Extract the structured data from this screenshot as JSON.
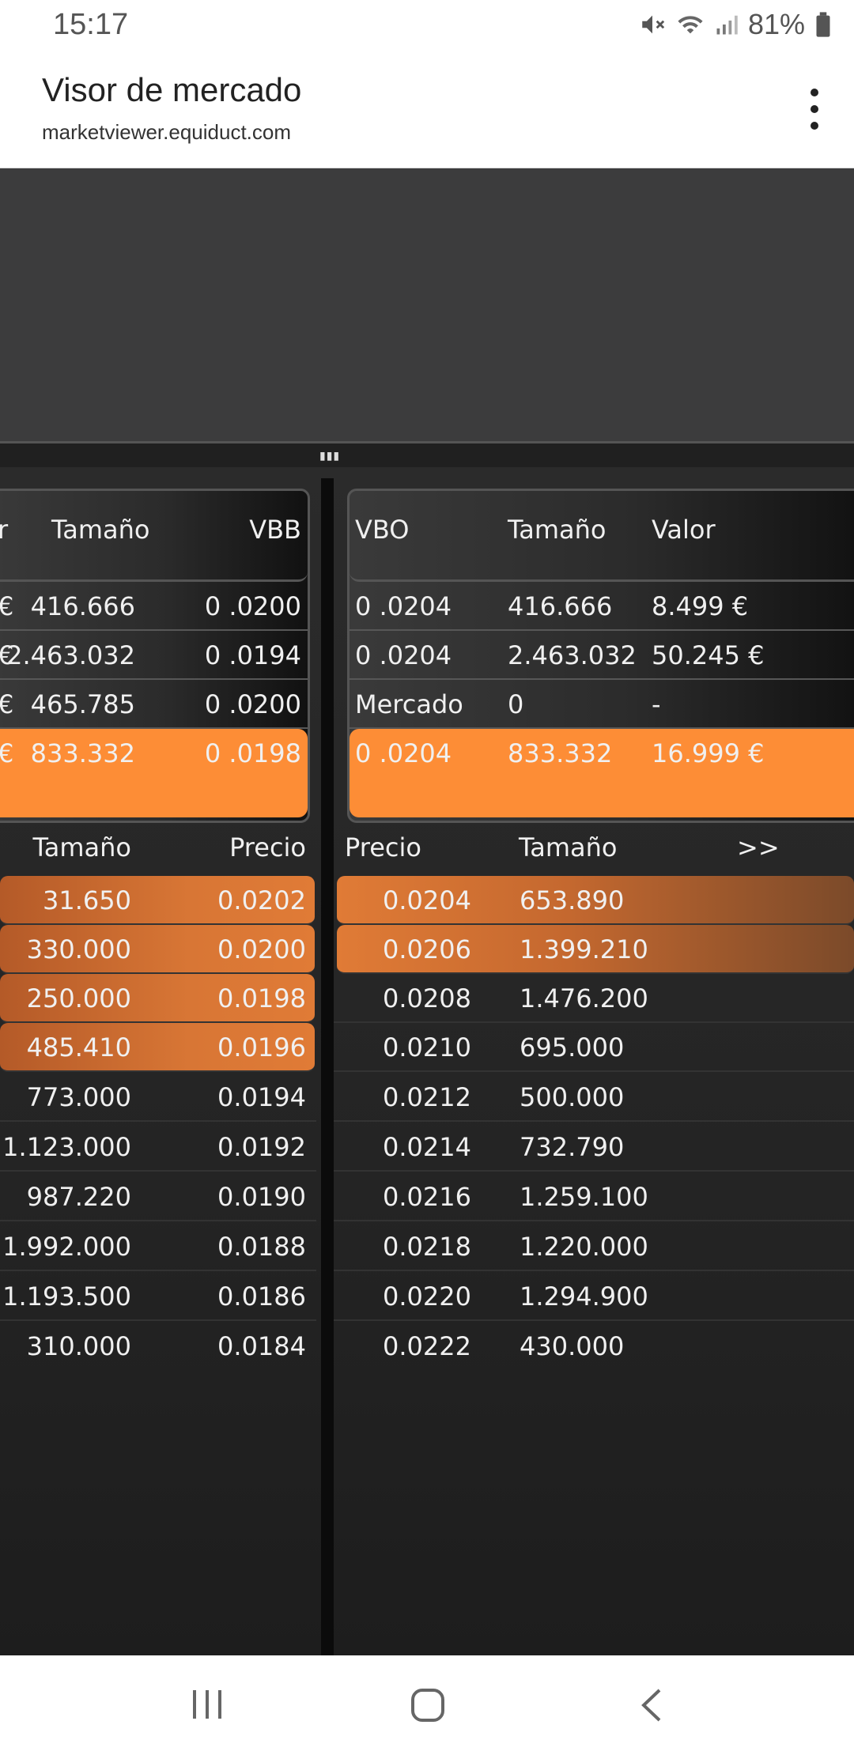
{
  "status": {
    "time": "15:17",
    "battery": "81%"
  },
  "browser": {
    "title": "Visor de mercado",
    "url": "marketviewer.equiduct.com"
  },
  "left_panel": {
    "headers": [
      "r",
      "Tamaño",
      "VBB"
    ],
    "rows": [
      {
        "c0": "€",
        "size": "416.666",
        "vbb": "0 .0200"
      },
      {
        "c0": "€",
        "size": "2.463.032",
        "vbb": "0 .0194"
      },
      {
        "c0": "€",
        "size": "465.785",
        "vbb": "0 .0200"
      },
      {
        "c0": "€",
        "size": "833.332",
        "vbb": "0 .0198"
      }
    ]
  },
  "right_panel": {
    "headers": [
      "VBO",
      "Tamaño",
      "Valor"
    ],
    "rows": [
      {
        "vbo": "0 .0204",
        "size": "416.666",
        "value": "8.499 €"
      },
      {
        "vbo": "0 .0204",
        "size": "2.463.032",
        "value": "50.245 €"
      },
      {
        "vbo": "Mercado",
        "size": "0",
        "value": "-"
      },
      {
        "vbo": "0 .0204",
        "size": "833.332",
        "value": "16.999 €"
      }
    ]
  },
  "bid_book": {
    "headers": [
      "Tamaño",
      "Precio"
    ],
    "rows": [
      {
        "size": "31.650",
        "price": "0.0202"
      },
      {
        "size": "330.000",
        "price": "0.0200"
      },
      {
        "size": "250.000",
        "price": "0.0198"
      },
      {
        "size": "485.410",
        "price": "0.0196"
      },
      {
        "size": "773.000",
        "price": "0.0194"
      },
      {
        "size": "1.123.000",
        "price": "0.0192"
      },
      {
        "size": "987.220",
        "price": "0.0190"
      },
      {
        "size": "1.992.000",
        "price": "0.0188"
      },
      {
        "size": "1.193.500",
        "price": "0.0186"
      },
      {
        "size": "310.000",
        "price": "0.0184"
      }
    ]
  },
  "ask_book": {
    "headers": [
      "Precio",
      "Tamaño",
      ">>"
    ],
    "rows": [
      {
        "price": "0.0204",
        "size": "653.890"
      },
      {
        "price": "0.0206",
        "size": "1.399.210"
      },
      {
        "price": "0.0208",
        "size": "1.476.200"
      },
      {
        "price": "0.0210",
        "size": "695.000"
      },
      {
        "price": "0.0212",
        "size": "500.000"
      },
      {
        "price": "0.0214",
        "size": "732.790"
      },
      {
        "price": "0.0216",
        "size": "1.259.100"
      },
      {
        "price": "0.0218",
        "size": "1.220.000"
      },
      {
        "price": "0.0220",
        "size": "1.294.900"
      },
      {
        "price": "0.0222",
        "size": "430.000"
      }
    ]
  },
  "colors": {
    "accent": "#fd8d36",
    "bid_highlight": "#d87635",
    "dark_bg": "#2b2b2b"
  },
  "icons": [
    "mute-icon",
    "wifi-icon",
    "signal-icon",
    "battery-icon",
    "more-vert-icon",
    "recents-icon",
    "home-icon",
    "back-icon"
  ]
}
